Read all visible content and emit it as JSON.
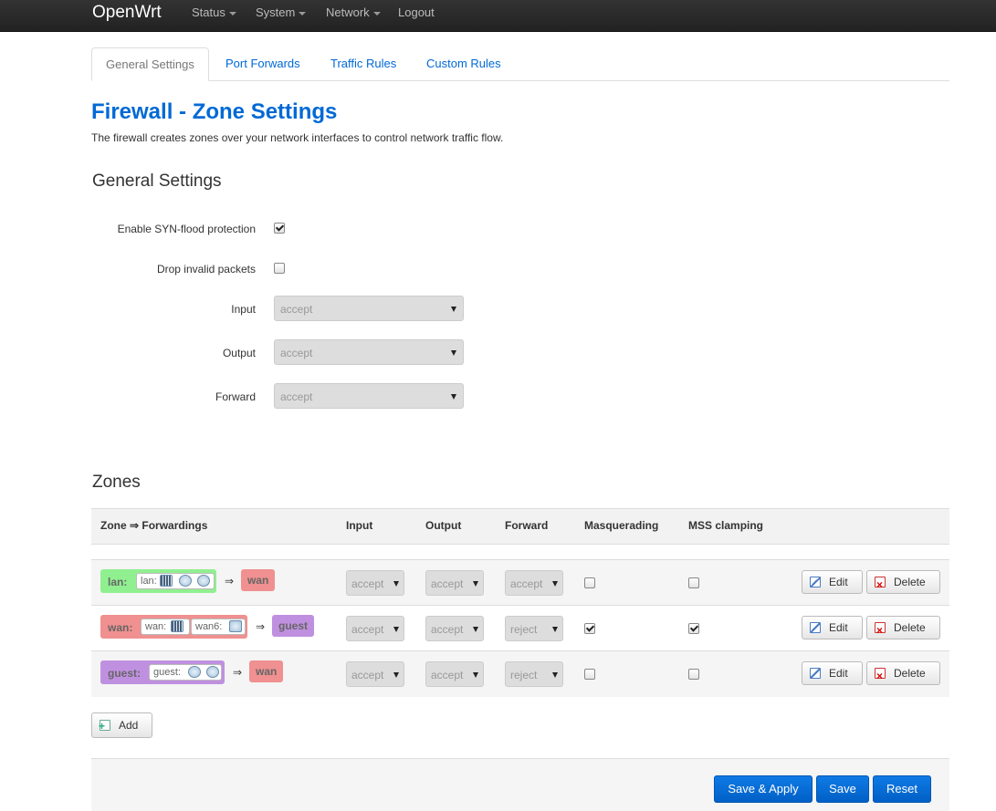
{
  "nav": {
    "brand": "OpenWrt",
    "items": [
      {
        "label": "Status",
        "dropdown": true
      },
      {
        "label": "System",
        "dropdown": true
      },
      {
        "label": "Network",
        "dropdown": true
      },
      {
        "label": "Logout",
        "dropdown": false
      }
    ]
  },
  "tabs": [
    {
      "label": "General Settings",
      "active": true
    },
    {
      "label": "Port Forwards",
      "active": false
    },
    {
      "label": "Traffic Rules",
      "active": false
    },
    {
      "label": "Custom Rules",
      "active": false
    }
  ],
  "page": {
    "title": "Firewall - Zone Settings",
    "description": "The firewall creates zones over your network interfaces to control network traffic flow."
  },
  "general": {
    "title": "General Settings",
    "syn_flood": {
      "label": "Enable SYN-flood protection",
      "checked": true
    },
    "drop_invalid": {
      "label": "Drop invalid packets",
      "checked": false
    },
    "input": {
      "label": "Input",
      "value": "accept"
    },
    "output": {
      "label": "Output",
      "value": "accept"
    },
    "forward": {
      "label": "Forward",
      "value": "accept"
    }
  },
  "zones": {
    "title": "Zones",
    "headers": [
      "Zone ⇒ Forwardings",
      "Input",
      "Output",
      "Forward",
      "Masquerading",
      "MSS clamping"
    ],
    "arrow": "⇒",
    "rows": [
      {
        "name": "lan:",
        "ifaces": [
          {
            "label": "lan:"
          }
        ],
        "dest": "wan",
        "input": "accept",
        "output": "accept",
        "forward": "accept",
        "masq": false,
        "mss": false
      },
      {
        "name": "wan:",
        "ifaces": [
          {
            "label": "wan:"
          },
          {
            "label": "wan6:"
          }
        ],
        "dest": "guest",
        "input": "accept",
        "output": "accept",
        "forward": "reject",
        "masq": true,
        "mss": true
      },
      {
        "name": "guest:",
        "ifaces": [
          {
            "label": "guest:"
          }
        ],
        "dest": "wan",
        "input": "accept",
        "output": "accept",
        "forward": "reject",
        "masq": false,
        "mss": false
      }
    ],
    "edit_label": "Edit",
    "delete_label": "Delete",
    "add_label": "Add"
  },
  "footer": {
    "save_apply": "Save & Apply",
    "save": "Save",
    "reset": "Reset"
  },
  "colors": {
    "lan": "#90f090",
    "wan": "#f09090",
    "guest": "#c090e0",
    "accent": "#0069d6"
  }
}
